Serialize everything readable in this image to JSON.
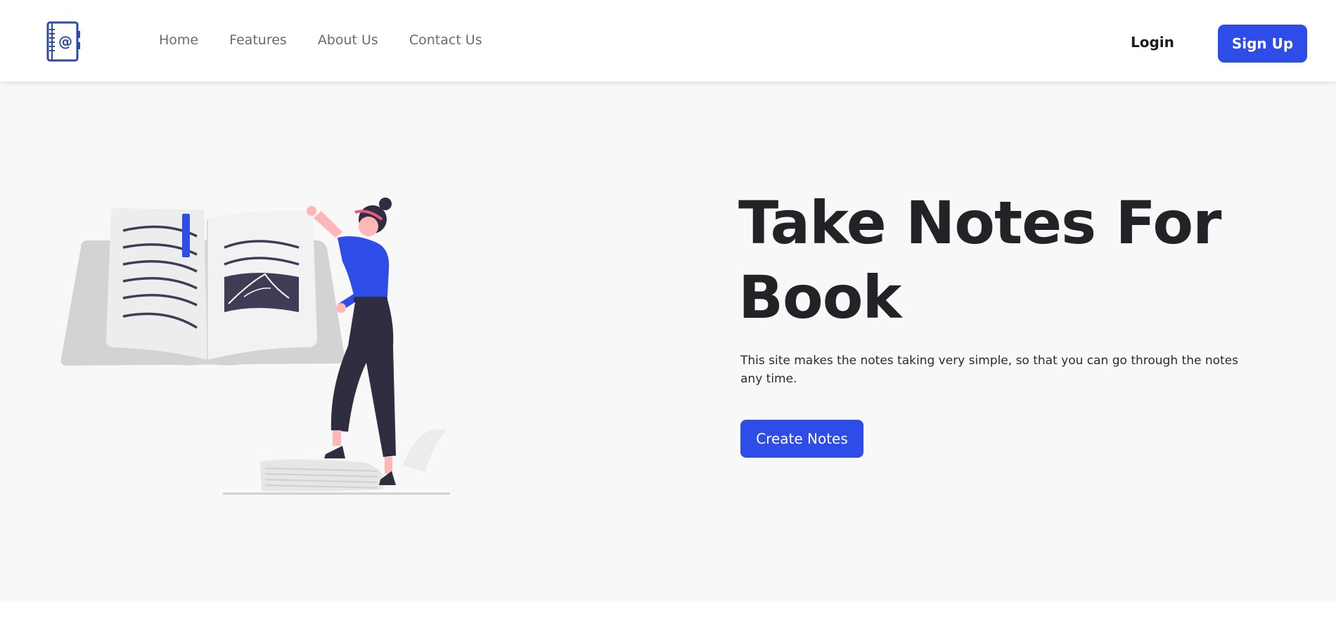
{
  "logo": {
    "icon": "address-book-icon",
    "color": "#2d4aa8"
  },
  "nav": {
    "links": [
      {
        "label": "Home"
      },
      {
        "label": "Features"
      },
      {
        "label": "About Us"
      },
      {
        "label": "Contact Us"
      }
    ],
    "login_label": "Login",
    "signup_label": "Sign Up"
  },
  "hero": {
    "title": "Take Notes For Book",
    "description": "This site makes the notes taking very simple, so that you can go through the notes any time.",
    "cta_label": "Create Notes",
    "illustration": "woman-reading-open-book-illustration"
  },
  "colors": {
    "accent": "#2d4ce8",
    "heading": "#212327",
    "hero_background": "#f8f8f8",
    "figure_dark": "#2f2e41",
    "figure_skin": "#ffb6b6"
  }
}
